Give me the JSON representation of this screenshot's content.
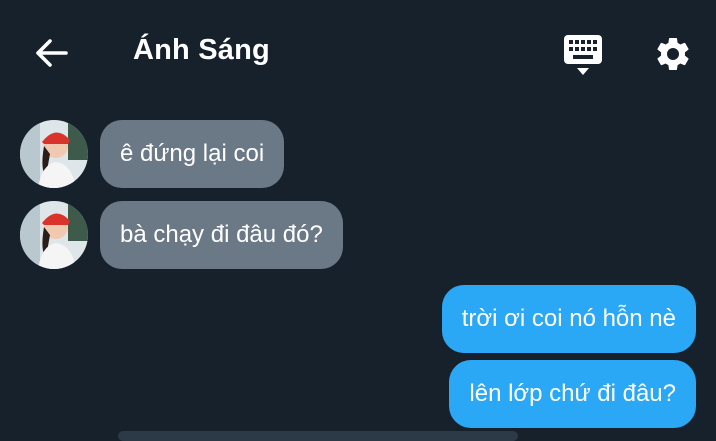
{
  "header": {
    "title": "Ánh Sáng"
  },
  "messages": [
    {
      "direction": "incoming",
      "text": "ê đứng lại coi"
    },
    {
      "direction": "incoming",
      "text": "bà chạy đi đâu đó?"
    },
    {
      "direction": "outgoing",
      "text": "trời ơi coi nó hỗn nè"
    },
    {
      "direction": "outgoing",
      "text": "lên lớp chứ đi đâu?"
    }
  ],
  "colors": {
    "background": "#17212b",
    "incoming_bubble": "#6b7886",
    "outgoing_bubble": "#2aa7f5"
  },
  "icons": {
    "back": "arrow-left-icon",
    "keyboard": "keyboard-icon",
    "settings": "gear-icon"
  }
}
